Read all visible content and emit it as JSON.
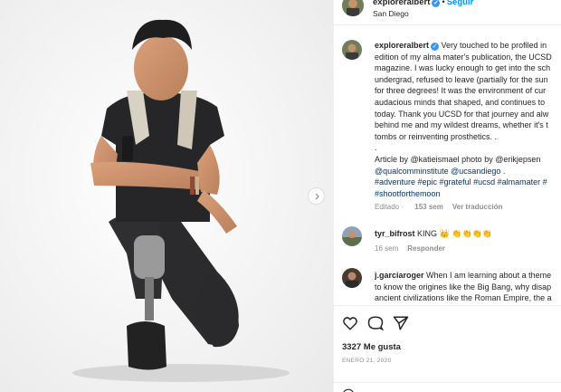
{
  "post": {
    "username": "exploreralbert",
    "verified_mark": "✓",
    "follow_label": "Seguir",
    "separator": "•",
    "location": "San Diego"
  },
  "caption": {
    "username": "exploreralbert",
    "lines": [
      "Very touched to be profiled in",
      "edition of my alma mater's publication, the UCSD",
      "magazine. I was lucky enough to get into the sch",
      "undergrad, refused to leave (partially for the sun",
      "for three degrees! It was the environment of cur",
      "audacious minds that shaped, and continues to",
      "today. Thank you UCSD for that journey and alw",
      "behind me and my wildest dreams, whether it's t",
      "tombs or reinventing prosthetics. .",
      ".",
      "Article by @katieismael photo by @erikjepsen",
      "@qualcomminstitute @ucsandiego .",
      "#adventure #epic #grateful #ucsd #almamater #",
      "#shootforthemoon"
    ],
    "edited_label": "Editado",
    "age": "153 sem",
    "translate_label": "Ver traducción"
  },
  "comments": [
    {
      "username": "tyr_bifrost",
      "text": "KING 👑 👏👏👏👏",
      "age": "16 sem",
      "reply_label": "Responder"
    },
    {
      "username": "j.garciaroger",
      "lines": [
        "When I am learning about a theme",
        "to know the origines like the Big Bang, why disap",
        "ancient civilizations like the Roman Empire, the a"
      ]
    }
  ],
  "actions": {
    "like_icon": "heart-icon",
    "comment_icon": "comment-icon",
    "share_icon": "share-icon",
    "likes_count": "3327",
    "likes_label": "Me gusta",
    "date": "ENERO 21, 2020"
  },
  "colors": {
    "link": "#00376b",
    "follow": "#0095f6",
    "secondary": "#8e8e8e",
    "verified": "#3897f0"
  }
}
